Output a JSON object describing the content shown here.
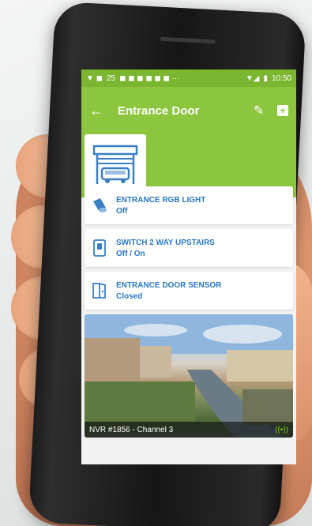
{
  "status_bar": {
    "battery": "25",
    "time": "10:50"
  },
  "app_bar": {
    "back_icon": "back-arrow-icon",
    "title": "Entrance Door",
    "edit_icon": "pencil-icon",
    "add_icon": "add-icon"
  },
  "hero": {
    "icon": "garage-icon"
  },
  "devices": [
    {
      "name": "ENTRANCE RGB LIGHT",
      "state": "Off",
      "icon": "lamp-icon"
    },
    {
      "name": "SWITCH 2 WAY UPSTAIRS",
      "state": "Off / On",
      "icon": "switch-icon"
    },
    {
      "name": "ENTRANCE DOOR SENSOR",
      "state": "Closed",
      "icon": "door-sensor-icon"
    }
  ],
  "camera": {
    "label": "NVR #1856 - Channel 3",
    "live_icon": "live-stream-icon"
  },
  "colors": {
    "primary": "#8cc63f",
    "status_bar": "#7ab62f",
    "text_accent": "#2a78c5"
  }
}
